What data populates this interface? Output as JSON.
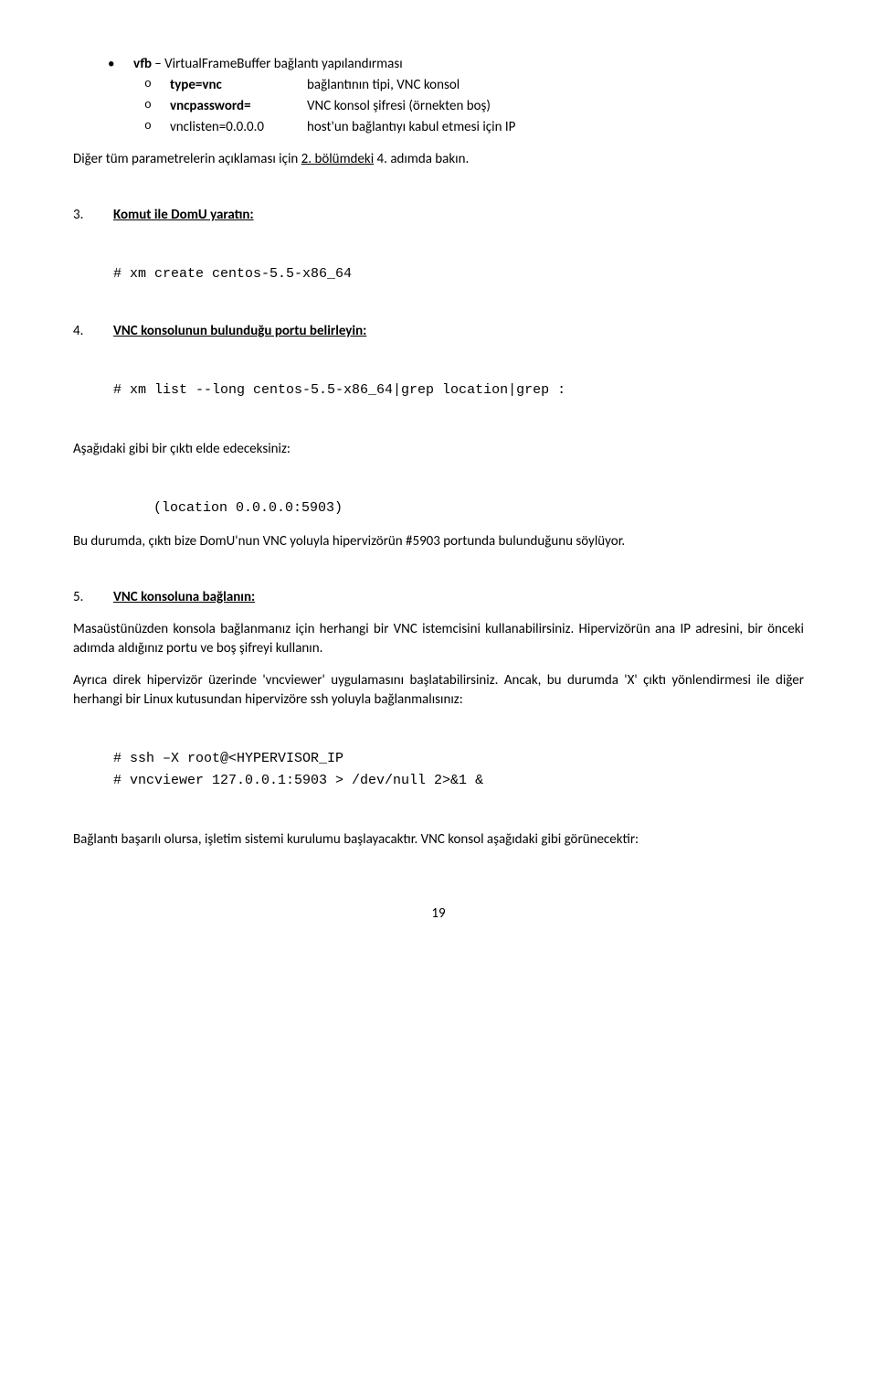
{
  "top": {
    "vfb_key": "vfb",
    "vfb_desc": " – VirtualFrameBuffer bağlantı yapılandırması",
    "type_key": "type=vnc",
    "type_desc": "bağlantının tipi, VNC konsol",
    "vncpass_key": "vncpassword=",
    "vncpass_desc": "VNC konsol şifresi (örnekten boş)",
    "vnclisten_key": "vnclisten=0.0.0.0",
    "vnclisten_desc": "host'un bağlantıyı kabul etmesi için IP"
  },
  "diger_para_a": "Diğer tüm parametrelerin açıklaması için ",
  "diger_para_link": "2. bölümdeki",
  "diger_para_b": " 4. adımda bakın.",
  "sec3": {
    "num": "3.",
    "title": "Komut ile DomU yaratın:",
    "code": "# xm create centos-5.5-x86_64"
  },
  "sec4": {
    "num": "4.",
    "title": "VNC konsolunun bulunduğu portu belirleyin:",
    "code": "# xm list --long centos-5.5-x86_64|grep location|grep :",
    "para1": "Aşağıdaki gibi bir çıktı elde edeceksiniz:",
    "code2": "(location 0.0.0.0:5903)",
    "para2": "Bu durumda, çıktı bize DomU'nun VNC yoluyla hipervizörün #5903 portunda bulunduğunu söylüyor."
  },
  "sec5": {
    "num": "5.",
    "title": "VNC konsoluna bağlanın:",
    "para1": "Masaüstünüzden konsola bağlanmanız için herhangi bir VNC istemcisini kullanabilirsiniz. Hipervizörün ana IP adresini, bir önceki adımda aldığınız portu ve boş şifreyi kullanın.",
    "para2": "Ayrıca direk hipervizör üzerinde 'vncviewer' uygulamasını başlatabilirsiniz. Ancak, bu durumda 'X' çıktı yönlendirmesi ile diğer herhangi bir Linux kutusundan hipervizöre ssh yoluyla bağlanmalısınız:",
    "code": "# ssh –X root@<HYPERVISOR_IP\n# vncviewer 127.0.0.1:5903 > /dev/null 2>&1 &",
    "para3": "Bağlantı başarılı olursa, işletim sistemi kurulumu başlayacaktır. VNC konsol aşağıdaki gibi görünecektir:"
  },
  "page_number": "19"
}
